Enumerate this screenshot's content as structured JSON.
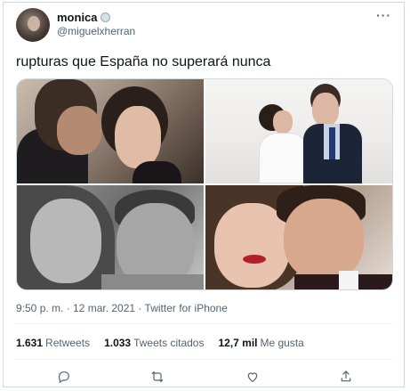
{
  "tweet": {
    "display_name": "monica",
    "handle": "@miguelxherran",
    "more_icon": "more-dots-icon",
    "text": "rupturas que España no superará nunca",
    "timestamp": "9:50 p. m. · 12 mar. 2021 · Twitter for iPhone",
    "stats": [
      {
        "count": "1.631",
        "label": "Retweets"
      },
      {
        "count": "1.033",
        "label": "Tweets citados"
      },
      {
        "count": "12,7 mil",
        "label": "Me gusta"
      }
    ],
    "actions": [
      "reply-icon",
      "retweet-icon",
      "like-icon",
      "share-icon"
    ]
  },
  "colors": {
    "text": "#0f1419",
    "secondary": "#536471",
    "border": "#cfd9de"
  }
}
